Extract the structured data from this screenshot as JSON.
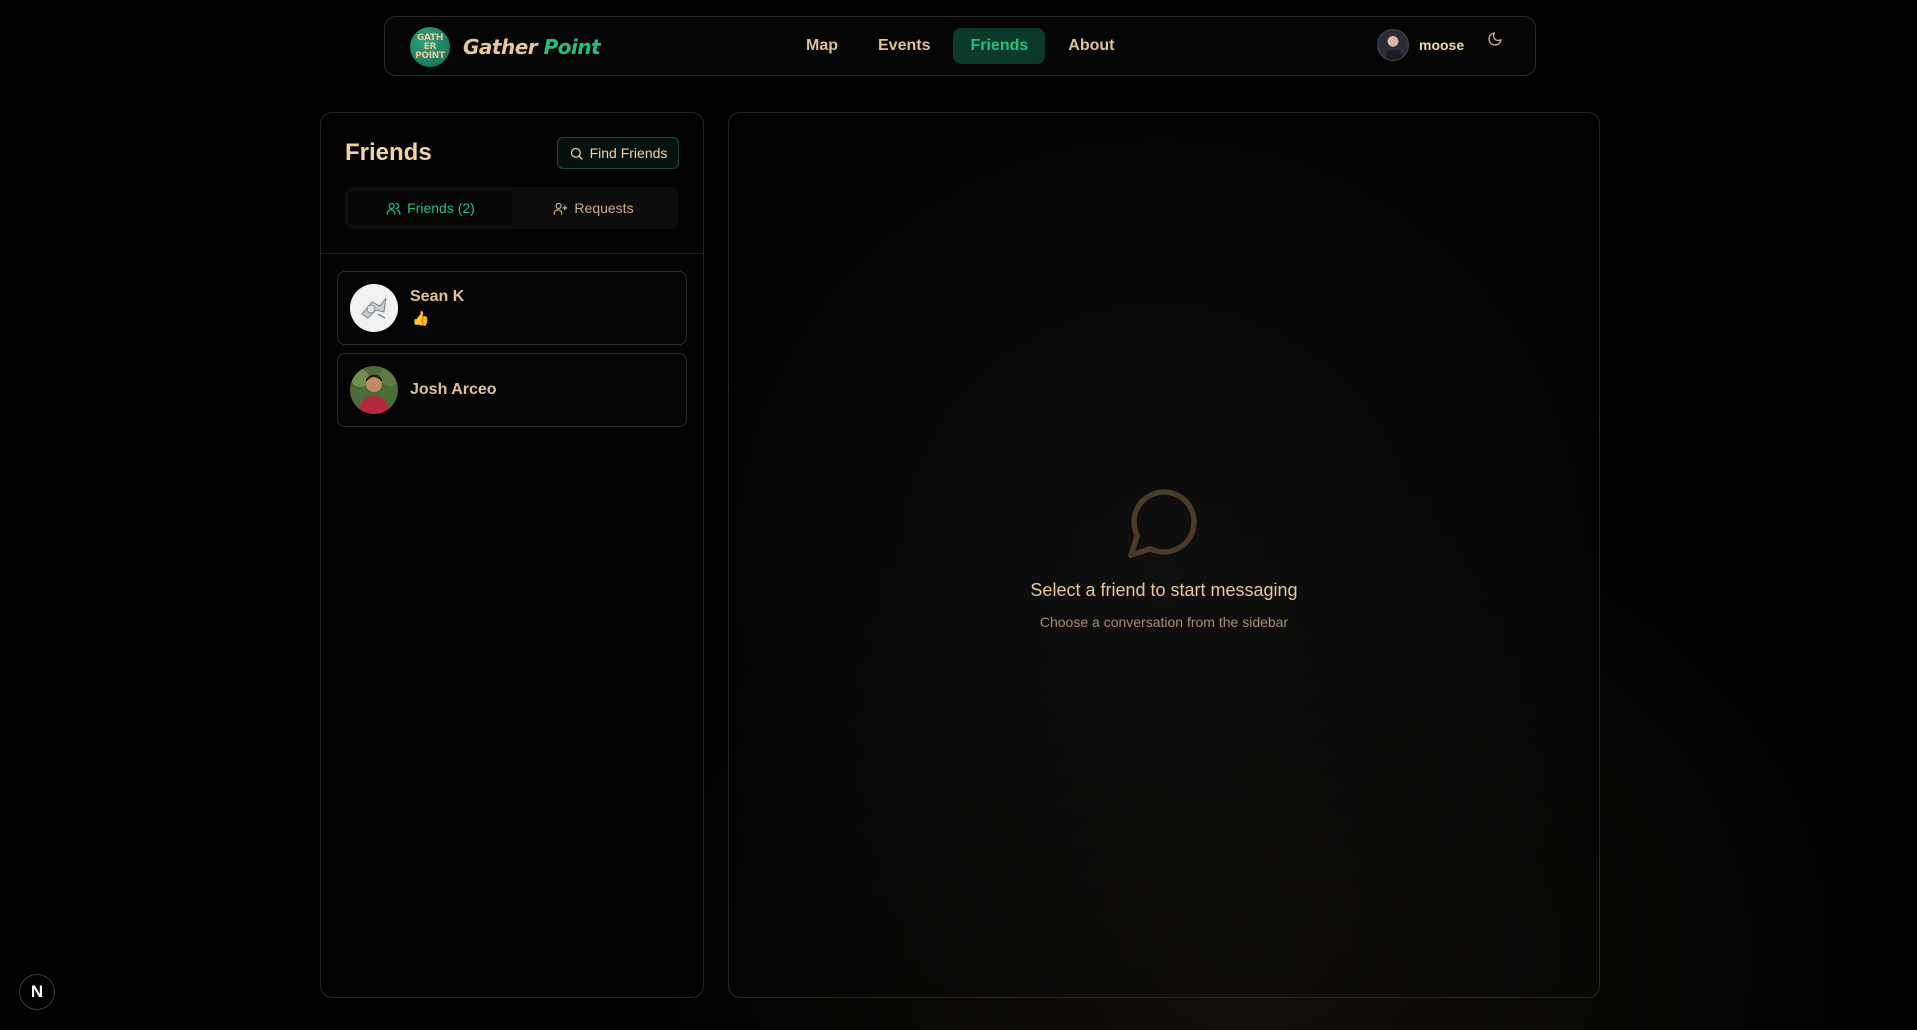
{
  "brand": {
    "logo_text": "GATHER POINT",
    "name_part1": "Gather",
    "name_part2": "Point"
  },
  "nav": {
    "links": [
      "Map",
      "Events",
      "Friends",
      "About"
    ],
    "active": "Friends"
  },
  "user": {
    "name": "moose"
  },
  "sidebar": {
    "title": "Friends",
    "find_button": "Find Friends",
    "tabs": [
      {
        "label": "Friends (2)",
        "active": true
      },
      {
        "label": "Requests",
        "active": false
      }
    ],
    "friends": [
      {
        "name": "Sean K",
        "status": "👍"
      },
      {
        "name": "Josh Arceo",
        "status": ""
      }
    ]
  },
  "chat": {
    "empty_title": "Select a friend to start messaging",
    "empty_subtitle": "Choose a conversation from the sidebar"
  },
  "colors": {
    "accent": "#22c07f",
    "text": "#e8c79a",
    "border": "#262626"
  },
  "dev_badge": "N"
}
